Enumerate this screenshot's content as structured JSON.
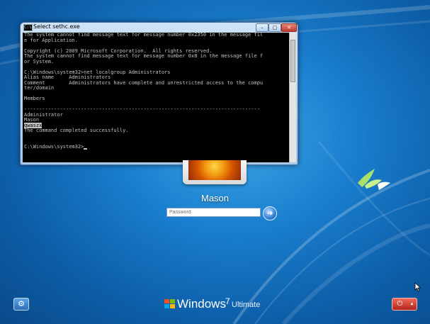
{
  "console_window": {
    "title": "Select sethc.exe",
    "icon": "console-icon",
    "icon_glyph": "C:\\",
    "lines": [
      "The system cannot find message text for message number 0x2350 in the message fil",
      "e for Application.",
      "",
      "Copyright (c) 2009 Microsoft Corporation.  All rights reserved.",
      "The system cannot find message text for message number 0x8 in the message file f",
      "or System.",
      "",
      "C:\\Windows\\system32>net localgroup Administrators",
      "Alias name     Administrators",
      "Comment        Administrators have complete and unrestricted access to the compu",
      "ter/domain",
      "",
      "Members",
      "",
      "-------------------------------------------------------------------------------",
      "Administrator",
      "Mason",
      "qwaszx",
      "The command completed successfully.",
      "",
      "",
      "C:\\Windows\\system32>"
    ],
    "selected_line_index": 17
  },
  "logon": {
    "username": "Mason",
    "password_placeholder": "Password"
  },
  "branding": {
    "name": "Windows",
    "version": "7",
    "edition": "Ultimate"
  },
  "icons": {
    "ease_of_access": "ease-of-access-icon",
    "go": "arrow-right-icon",
    "power": "power-icon",
    "power_options": "chevron-up-icon",
    "windows_logo": "windows-flag-icon"
  },
  "colors": {
    "background": "#1a7fcf",
    "console_bg": "#000000",
    "console_fg": "#c0c0c0",
    "power_red": "#c0392b"
  }
}
